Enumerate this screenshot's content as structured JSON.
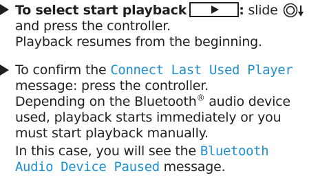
{
  "step1": {
    "bold_text": "To select start playback",
    "colon": ":",
    "slide_text": " slide",
    "line2": "and press the controller.",
    "line3": "Playback resumes from the beginning."
  },
  "step2": {
    "line1_prefix": "To confirm the ",
    "message1": "Connect Last Used Player",
    "line2": "message: press the controller.",
    "line3_a": "Depending on the Bluetooth",
    "registered": "®",
    "line3_b": " audio device",
    "line4": "used, playback starts immediately or you",
    "line5": "must start playback manually.",
    "line6_prefix": "In this case, you will see the ",
    "message2_a": "Bluetooth",
    "message2_b": "Audio Device Paused",
    "line7_suffix": " message."
  },
  "icons": {
    "bullet": "triangle-bullet",
    "play_button": "play-button",
    "controller": "controller-slide-down"
  }
}
